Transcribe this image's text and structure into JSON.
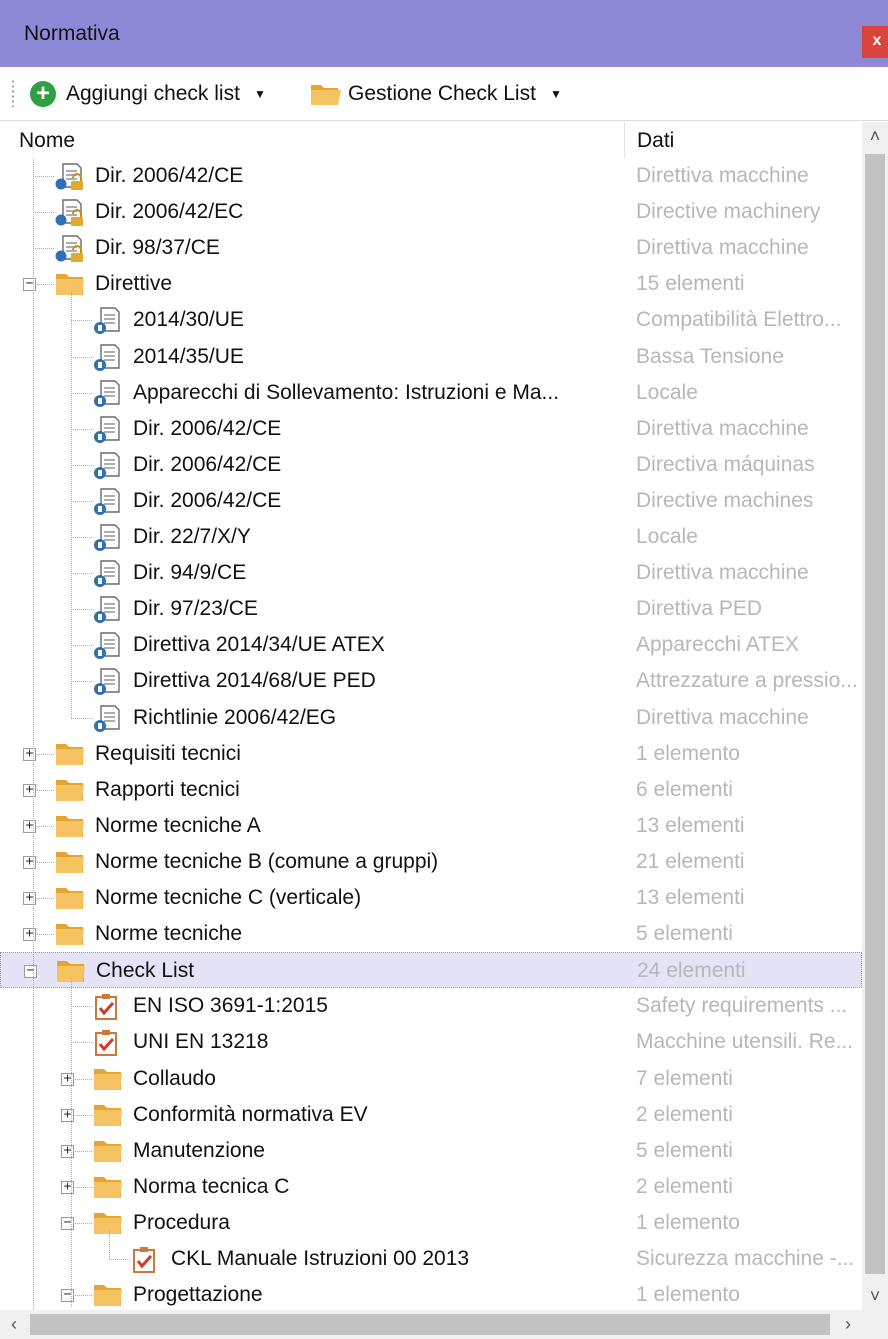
{
  "window": {
    "title": "Normativa",
    "close_label": "x"
  },
  "toolbar": {
    "add_label": "Aggiungi check list",
    "manage_label": "Gestione Check List",
    "dropdown_glyph": "▼"
  },
  "columns": {
    "name": "Nome",
    "data": "Dati"
  },
  "tree": [
    {
      "label": "Dir. 2006/42/CE",
      "data": "Direttiva macchine",
      "icon": "locked-document-icon",
      "level": 0
    },
    {
      "label": "Dir. 2006/42/EC",
      "data": "Directive machinery",
      "icon": "locked-document-icon",
      "level": 0
    },
    {
      "label": "Dir. 98/37/CE",
      "data": "Direttiva macchine",
      "icon": "locked-document-icon",
      "level": 0
    },
    {
      "label": "Direttive",
      "data": "15 elementi",
      "icon": "folder-icon",
      "level": 0,
      "expanded": true
    },
    {
      "label": "2014/30/UE",
      "data": "Compatibilità Elettro...",
      "icon": "document-icon",
      "level": 1
    },
    {
      "label": "2014/35/UE",
      "data": "Bassa Tensione",
      "icon": "document-icon",
      "level": 1
    },
    {
      "label": "Apparecchi di Sollevamento: Istruzioni e Ma...",
      "data": "Locale",
      "icon": "document-icon",
      "level": 1
    },
    {
      "label": "Dir. 2006/42/CE",
      "data": "Direttiva macchine",
      "icon": "document-icon",
      "level": 1
    },
    {
      "label": "Dir. 2006/42/CE",
      "data": "Directiva máquinas",
      "icon": "document-icon",
      "level": 1
    },
    {
      "label": "Dir. 2006/42/CE",
      "data": "Directive machines",
      "icon": "document-icon",
      "level": 1
    },
    {
      "label": "Dir. 22/7/X/Y",
      "data": "Locale",
      "icon": "document-icon",
      "level": 1
    },
    {
      "label": "Dir. 94/9/CE",
      "data": "Direttiva macchine",
      "icon": "document-icon",
      "level": 1
    },
    {
      "label": "Dir. 97/23/CE",
      "data": "Direttiva PED",
      "icon": "document-icon",
      "level": 1
    },
    {
      "label": "Direttiva 2014/34/UE ATEX",
      "data": "Apparecchi ATEX",
      "icon": "document-icon",
      "level": 1
    },
    {
      "label": "Direttiva 2014/68/UE PED",
      "data": "Attrezzature a pressio...",
      "icon": "document-icon",
      "level": 1
    },
    {
      "label": "Richtlinie 2006/42/EG",
      "data": "Direttiva macchine",
      "icon": "document-icon",
      "level": 1
    },
    {
      "label": "Requisiti tecnici",
      "data": "1 elemento",
      "icon": "folder-icon",
      "level": 0,
      "expanded": false
    },
    {
      "label": "Rapporti tecnici",
      "data": "6 elementi",
      "icon": "folder-icon",
      "level": 0,
      "expanded": false
    },
    {
      "label": "Norme tecniche A",
      "data": "13 elementi",
      "icon": "folder-icon",
      "level": 0,
      "expanded": false
    },
    {
      "label": "Norme tecniche B (comune a gruppi)",
      "data": "21 elementi",
      "icon": "folder-icon",
      "level": 0,
      "expanded": false
    },
    {
      "label": "Norme tecniche C (verticale)",
      "data": "13 elementi",
      "icon": "folder-icon",
      "level": 0,
      "expanded": false
    },
    {
      "label": "Norme tecniche",
      "data": "5 elementi",
      "icon": "folder-icon",
      "level": 0,
      "expanded": false
    },
    {
      "label": "Check List",
      "data": "24 elementi",
      "icon": "folder-icon",
      "level": 0,
      "expanded": true,
      "selected": true
    },
    {
      "label": "EN ISO 3691-1:2015",
      "data": "Safety requirements ...",
      "icon": "checklist-icon",
      "level": 1
    },
    {
      "label": "UNI EN 13218",
      "data": "Macchine utensili. Re...",
      "icon": "checklist-icon",
      "level": 1
    },
    {
      "label": "Collaudo",
      "data": "7 elementi",
      "icon": "folder-icon",
      "level": 1,
      "expanded": false
    },
    {
      "label": "Conformità normativa EV",
      "data": "2 elementi",
      "icon": "folder-icon",
      "level": 1,
      "expanded": false
    },
    {
      "label": "Manutenzione",
      "data": "5 elementi",
      "icon": "folder-icon",
      "level": 1,
      "expanded": false
    },
    {
      "label": "Norma tecnica C",
      "data": "2 elementi",
      "icon": "folder-icon",
      "level": 1,
      "expanded": false
    },
    {
      "label": "Procedura",
      "data": "1 elemento",
      "icon": "folder-icon",
      "level": 1,
      "expanded": true
    },
    {
      "label": "CKL Manuale Istruzioni 00 2013",
      "data": "Sicurezza macchine -...",
      "icon": "checklist-icon",
      "level": 2
    },
    {
      "label": "Progettazione",
      "data": "1 elemento",
      "icon": "folder-icon",
      "level": 1,
      "expanded": true
    }
  ],
  "colors": {
    "titlebar": "#8e89d6",
    "close_button": "#d9453a",
    "add_icon": "#2ea043",
    "folder": "#f2b84b",
    "data_text": "#b7b7b7",
    "selection": "#e5e3f7"
  }
}
